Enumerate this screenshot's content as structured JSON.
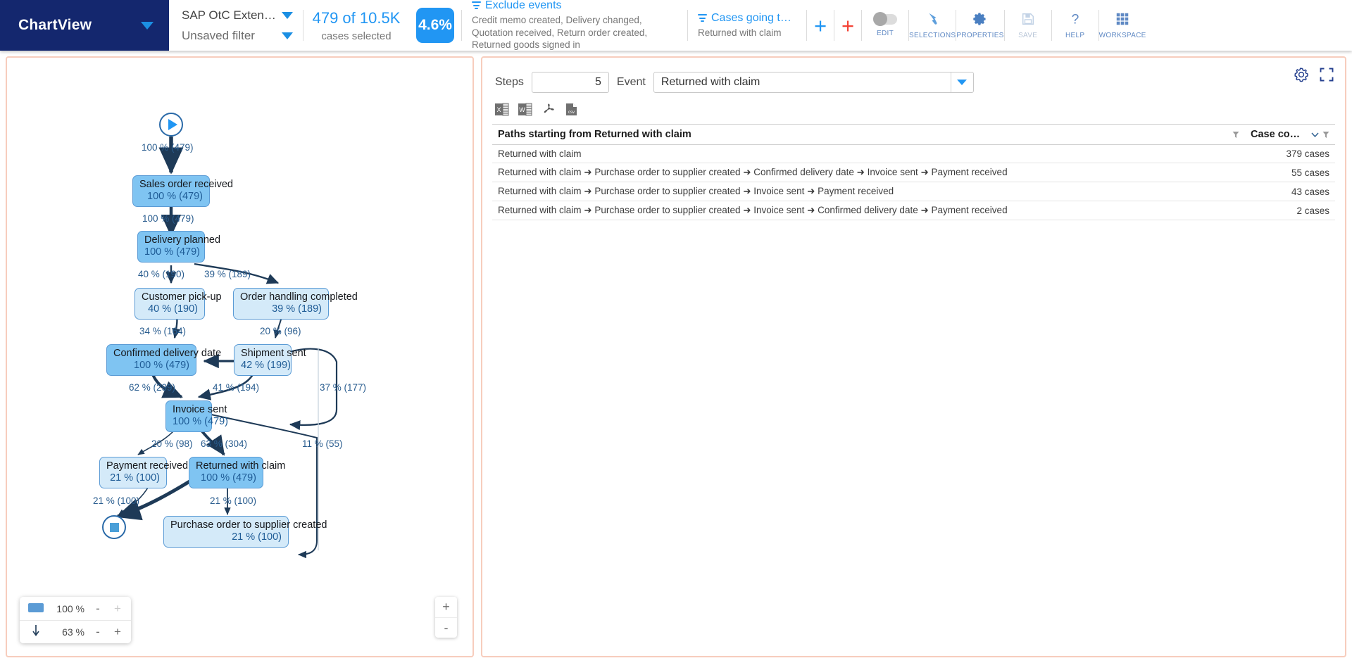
{
  "brand": {
    "title": "ChartView",
    "caret_icon": "chevron-down-icon"
  },
  "selector": {
    "dataset": "SAP OtC Extend…",
    "filter": "Unsaved filter"
  },
  "cases": {
    "count_text": "479 of 10.5K",
    "label": "cases selected",
    "percent": "4.6%"
  },
  "chips": [
    {
      "title": "Exclude events",
      "subtitle": "Credit memo created, Delivery changed, Quotation received, Return order created, Returned goods signed in",
      "icon": "filter-icon"
    },
    {
      "title": "Cases going thro…",
      "subtitle": "Returned with claim",
      "icon": "filter-icon"
    }
  ],
  "add_buttons": {
    "add_filter": "+",
    "add_exclude": "+"
  },
  "tools": [
    {
      "label": "EDIT",
      "icon": "toggle-switch-icon",
      "enabled": true
    },
    {
      "label": "SELECTIONS",
      "icon": "hand-pointer-icon",
      "enabled": true
    },
    {
      "label": "PROPERTIES",
      "icon": "gear-icon",
      "enabled": true
    },
    {
      "label": "SAVE",
      "icon": "floppy-disk-icon",
      "enabled": false
    },
    {
      "label": "HELP",
      "icon": "question-mark-icon",
      "enabled": true
    },
    {
      "label": "WORKSPACE",
      "icon": "grid-icon",
      "enabled": true
    }
  ],
  "graph": {
    "start_node": {
      "icon": "play-icon",
      "label": "100 % (479)"
    },
    "end_node": {
      "icon": "stop-icon"
    },
    "nodes": [
      {
        "id": "sales_order",
        "title": "Sales order received",
        "stat": "100 % (479)",
        "fill": "dark"
      },
      {
        "id": "delivery_plan",
        "title": "Delivery planned",
        "stat": "100 % (479)",
        "fill": "dark"
      },
      {
        "id": "customer_pick",
        "title": "Customer pick-up",
        "stat": "40 % (190)",
        "fill": "light"
      },
      {
        "id": "order_handling",
        "title": "Order handling completed",
        "stat": "39 % (189)",
        "fill": "light"
      },
      {
        "id": "confirmed_date",
        "title": "Confirmed delivery date",
        "stat": "100 % (479)",
        "fill": "dark"
      },
      {
        "id": "shipment_sent",
        "title": "Shipment sent",
        "stat": "42 % (199)",
        "fill": "light"
      },
      {
        "id": "invoice_sent",
        "title": "Invoice sent",
        "stat": "100 % (479)",
        "fill": "dark"
      },
      {
        "id": "payment_recv",
        "title": "Payment received",
        "stat": "21 % (100)",
        "fill": "light"
      },
      {
        "id": "returned_claim",
        "title": "Returned with claim",
        "stat": "100 % (479)",
        "fill": "dark"
      },
      {
        "id": "purchase_order",
        "title": "Purchase order to supplier created",
        "stat": "21 % (100)",
        "fill": "light"
      }
    ],
    "edge_labels": [
      {
        "id": "e_start",
        "text": "100 % (479)"
      },
      {
        "id": "e_sales",
        "text": "100 % (479)"
      },
      {
        "id": "e_dp_cp",
        "text": "40 % (190)"
      },
      {
        "id": "e_dp_oh",
        "text": "39 % (189)"
      },
      {
        "id": "e_cp_cd",
        "text": "34 % (164)"
      },
      {
        "id": "e_oh_ss",
        "text": "20 % (96)"
      },
      {
        "id": "e_cd_inv",
        "text": "62 % (299)"
      },
      {
        "id": "e_ss_inv",
        "text": "41 % (194)"
      },
      {
        "id": "e_loop_37",
        "text": "37 % (177)"
      },
      {
        "id": "e_inv_pay",
        "text": "20 % (98)"
      },
      {
        "id": "e_inv_ret",
        "text": "63 % (304)"
      },
      {
        "id": "e_loop_11",
        "text": "11 % (55)"
      },
      {
        "id": "e_pay_end",
        "text": "21 % (100)"
      },
      {
        "id": "e_ret_po",
        "text": "21 % (100)"
      }
    ],
    "sliders": [
      {
        "id": "activity",
        "icon": "node-swatch-icon",
        "value": "100 %",
        "minus": "-",
        "plus": "+",
        "plus_enabled": false
      },
      {
        "id": "path",
        "icon": "down-arrow-icon",
        "value": "63 %",
        "minus": "-",
        "plus": "+",
        "plus_enabled": true
      }
    ],
    "zoom_controls": {
      "zoom_in": "+",
      "zoom_out": "-"
    }
  },
  "right_panel": {
    "header_icons": [
      {
        "name": "settings-gear-icon"
      },
      {
        "name": "fullscreen-icon"
      }
    ],
    "steps": {
      "label": "Steps",
      "value": "5"
    },
    "event": {
      "label": "Event",
      "value": "Returned with claim",
      "caret_icon": "chevron-down-icon"
    },
    "exports": [
      {
        "name": "export-excel-icon",
        "glyph": "X"
      },
      {
        "name": "export-word-icon",
        "glyph": "W"
      },
      {
        "name": "export-pdf-icon",
        "glyph": "A"
      },
      {
        "name": "export-csv-icon",
        "glyph": "csv"
      }
    ],
    "table": {
      "columns": [
        {
          "key": "path",
          "label": "Paths starting from Returned with claim",
          "filter_icon": "filter-funnel-icon"
        },
        {
          "key": "cases",
          "label": "Case co…",
          "sort_icon": "chevron-down-icon",
          "filter_icon": "filter-funnel-icon"
        }
      ],
      "rows": [
        {
          "path": "Returned with claim",
          "cases": "379 cases"
        },
        {
          "path": "Returned with claim ➜ Purchase order to supplier created ➜ Confirmed delivery date ➜ Invoice sent ➜ Payment received",
          "cases": "55 cases"
        },
        {
          "path": "Returned with claim ➜ Purchase order to supplier created ➜ Invoice sent ➜ Payment received",
          "cases": "43 cases"
        },
        {
          "path": "Returned with claim ➜ Purchase order to supplier created ➜ Invoice sent ➜ Confirmed delivery date ➜ Payment received",
          "cases": "2 cases"
        }
      ]
    }
  },
  "colors": {
    "brand_navy": "#14276e",
    "accent_blue": "#2196f3",
    "node_dark": "#7fc4f2",
    "node_light": "#d4eaf9",
    "panel_border": "#f7cdbd",
    "edge_stroke": "#1e3a57"
  }
}
